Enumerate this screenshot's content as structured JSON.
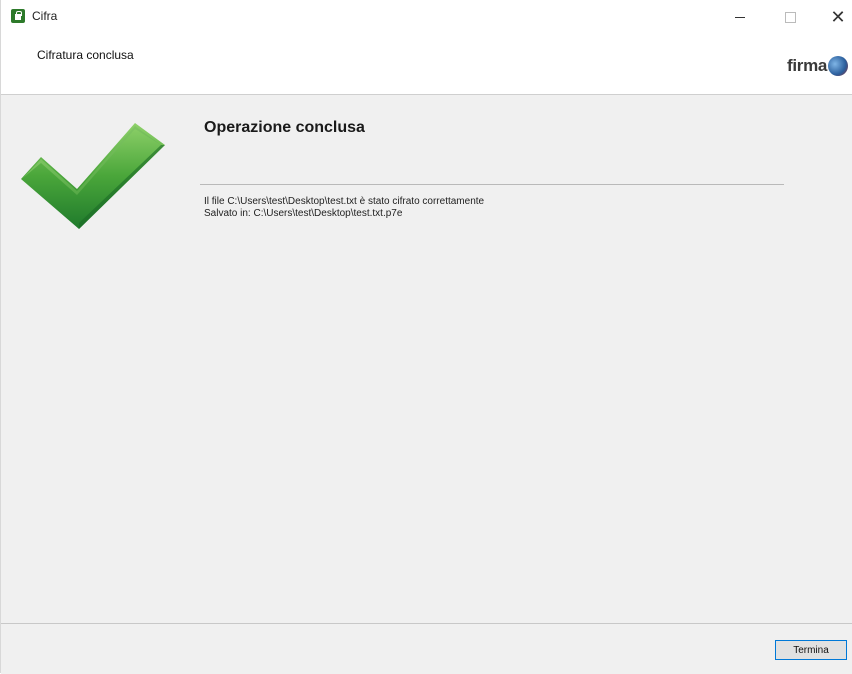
{
  "window": {
    "title": "Cifra",
    "app_icon": "lock-icon",
    "controls": {
      "minimize_icon": "minimize-icon",
      "maximize_icon": "maximize-icon",
      "close_icon": "close-icon",
      "close_glyph": "✕"
    }
  },
  "header": {
    "title": "Cifratura conclusa",
    "logo_text": "firma"
  },
  "main": {
    "status_icon": "checkmark-icon",
    "heading": "Operazione conclusa",
    "lines": [
      "Il file C:\\Users\\test\\Desktop\\test.txt è stato cifrato correttamente",
      "Salvato in: C:\\Users\\test\\Desktop\\test.txt.p7e"
    ]
  },
  "footer": {
    "finish_label": "Termina"
  },
  "colors": {
    "accent": "#0078d7",
    "check_green": "#4aa63a",
    "panel_bg": "#f0f0f0"
  }
}
